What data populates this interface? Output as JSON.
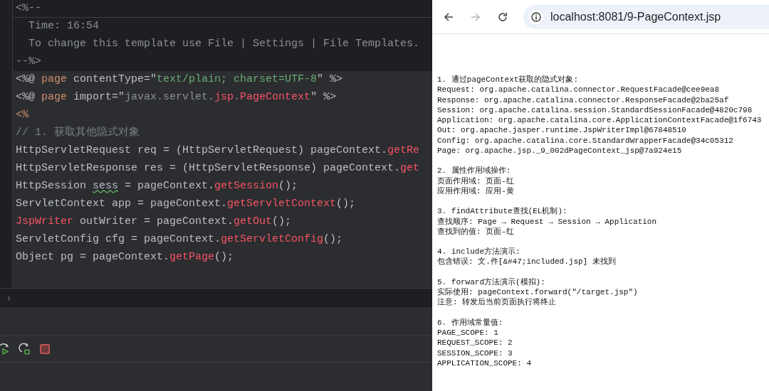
{
  "editor": {
    "lines": [
      {
        "shaded": false,
        "tokens": [
          {
            "kind": "gray",
            "text": "<%--"
          }
        ]
      },
      {
        "shaded": false,
        "tokens": [
          {
            "kind": "gray",
            "text": "  Time: 16:54"
          }
        ]
      },
      {
        "shaded": false,
        "tokens": [
          {
            "kind": "gray",
            "text": "  To change this template use File | Settings | File Templates."
          }
        ]
      },
      {
        "shaded": false,
        "tokens": [
          {
            "kind": "gray",
            "text": "--%>"
          }
        ]
      },
      {
        "shaded": true,
        "tokens": [
          {
            "kind": "plain",
            "text": "<%@ "
          },
          {
            "kind": "keyword",
            "text": "page"
          },
          {
            "kind": "plain",
            "text": " contentType=\""
          },
          {
            "kind": "string",
            "text": "text/plain; charset=UTF-8"
          },
          {
            "kind": "plain",
            "text": "\" %>"
          }
        ]
      },
      {
        "shaded": true,
        "tokens": [
          {
            "kind": "plain",
            "text": "<%@ "
          },
          {
            "kind": "keyword",
            "text": "page"
          },
          {
            "kind": "plain",
            "text": " import=\""
          },
          {
            "kind": "gray",
            "text": "javax.servlet."
          },
          {
            "kind": "red",
            "text": "jsp"
          },
          {
            "kind": "gray",
            "text": "."
          },
          {
            "kind": "red",
            "text": "PageContext"
          },
          {
            "kind": "plain",
            "text": "\" %>"
          }
        ]
      },
      {
        "shaded": true,
        "tokens": [
          {
            "kind": "keyword",
            "text": "<%"
          }
        ]
      },
      {
        "shaded": true,
        "tokens": [
          {
            "kind": "comment",
            "text": "// 1. 获取其他隐式对象"
          }
        ]
      },
      {
        "shaded": true,
        "tokens": [
          {
            "kind": "plain",
            "text": "HttpServletRequest req = (HttpServletRequest) pageContext."
          },
          {
            "kind": "red",
            "text": "getRe"
          }
        ]
      },
      {
        "shaded": true,
        "tokens": [
          {
            "kind": "plain",
            "text": "HttpServletResponse res = (HttpServletResponse) pageContext."
          },
          {
            "kind": "red",
            "text": "get"
          }
        ]
      },
      {
        "shaded": true,
        "tokens": [
          {
            "kind": "plain",
            "text": "HttpSession "
          },
          {
            "kind": "warn",
            "text": "sess"
          },
          {
            "kind": "plain",
            "text": " = pageContext."
          },
          {
            "kind": "red",
            "text": "getSession"
          },
          {
            "kind": "plain",
            "text": "();"
          }
        ]
      },
      {
        "shaded": true,
        "tokens": [
          {
            "kind": "plain",
            "text": "ServletContext app = pageContext."
          },
          {
            "kind": "red",
            "text": "getServletContext"
          },
          {
            "kind": "plain",
            "text": "();"
          }
        ]
      },
      {
        "shaded": true,
        "tokens": [
          {
            "kind": "red",
            "text": "JspWriter"
          },
          {
            "kind": "plain",
            "text": " outWriter = pageContext."
          },
          {
            "kind": "red",
            "text": "getOut"
          },
          {
            "kind": "plain",
            "text": "();"
          }
        ]
      },
      {
        "shaded": true,
        "tokens": [
          {
            "kind": "plain",
            "text": "ServletConfig cfg = pageContext."
          },
          {
            "kind": "red",
            "text": "getServletConfig"
          },
          {
            "kind": "plain",
            "text": "();"
          }
        ]
      },
      {
        "shaded": true,
        "tokens": [
          {
            "kind": "plain",
            "text": "Object pg = pageContext."
          },
          {
            "kind": "red",
            "text": "getPage"
          },
          {
            "kind": "plain",
            "text": "();"
          }
        ]
      }
    ],
    "breadcrumb_separator": "›"
  },
  "browser": {
    "url": "localhost:8081/9-PageContext.jsp",
    "forward_disabled": true,
    "sections": [
      [
        "1. 通过pageContext获取的隐式对象:",
        "Request: org.apache.catalina.connector.RequestFacade@cee9ea8",
        "Response: org.apache.catalina.connector.ResponseFacade@2ba25af",
        "Session: org.apache.catalina.session.StandardSessionFacade@4820c798",
        "Application: org.apache.catalina.core.ApplicationContextFacade@1f6743",
        "Out: org.apache.jasper.runtime.JspWriterImpl@67848510",
        "Config: org.apache.catalina.core.StandardWrapperFacade@34c05312",
        "Page: org.apache.jsp._9_002dPageContext_jsp@7a924e15"
      ],
      [
        "2. 属性作用域操作:",
        "页面作用域: 页面-红",
        "应用作用域: 应用-黄"
      ],
      [
        "3. findAttribute查找(EL机制):",
        "查找顺序: Page → Request → Session → Application",
        "查找到的值: 页面-红"
      ],
      [
        "4. include方法演示:",
        "包含错误: 文.件[&#47;included.jsp] 未找到"
      ],
      [
        "5. forward方法演示(模拟):",
        "实际使用: pageContext.forward(\"/target.jsp\")",
        "注意: 转发后当前页面执行将终止"
      ],
      [
        "6. 作用域常量值:",
        "PAGE_SCOPE: 1",
        "REQUEST_SCOPE: 2",
        "SESSION_SCOPE: 3",
        "APPLICATION_SCOPE: 4"
      ]
    ]
  }
}
